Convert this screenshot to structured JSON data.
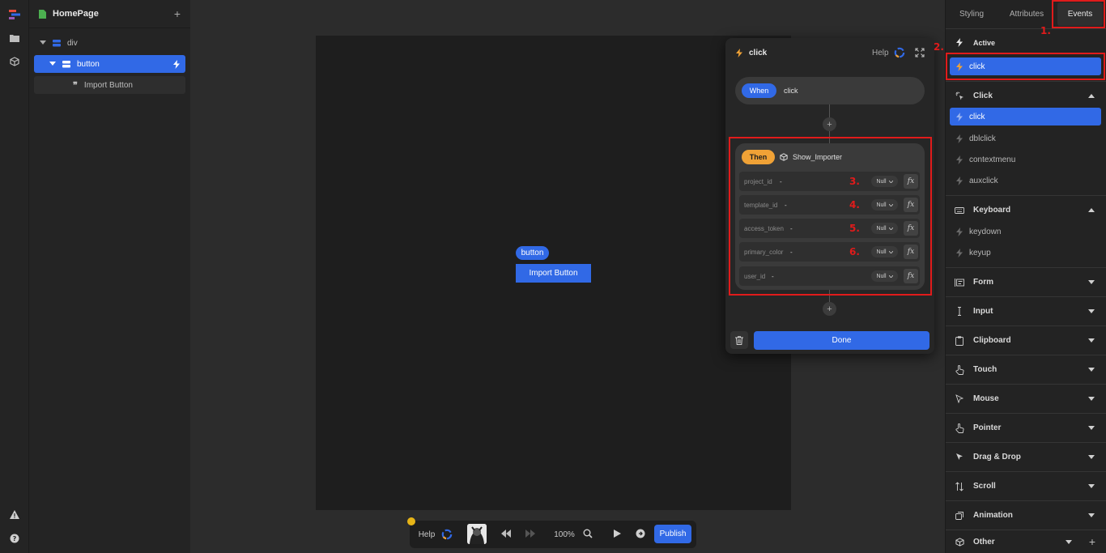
{
  "layers": {
    "page_title": "HomePage",
    "tree": [
      {
        "label": "div"
      },
      {
        "label": "button"
      },
      {
        "label": "Import Button"
      }
    ]
  },
  "canvas": {
    "element_tag": "button",
    "button_label": "Import Button"
  },
  "event_editor": {
    "title": "click",
    "help_label": "Help",
    "when_label": "When",
    "when_event": "click",
    "then_label": "Then",
    "action_name": "Show_Importer",
    "params": [
      {
        "name": "project_id",
        "value": "-",
        "type": "Null",
        "fx": "fx"
      },
      {
        "name": "template_id",
        "value": "-",
        "type": "Null",
        "fx": "fx"
      },
      {
        "name": "access_token",
        "value": "-",
        "type": "Null",
        "fx": "fx"
      },
      {
        "name": "primary_color",
        "value": "-",
        "type": "Null",
        "fx": "fx"
      },
      {
        "name": "user_id",
        "value": "-",
        "type": "Null",
        "fx": "fx"
      }
    ],
    "done_label": "Done"
  },
  "annotations": {
    "a1": "1.",
    "a2": "2.",
    "a3": "3.",
    "a4": "4.",
    "a5": "5.",
    "a6": "6."
  },
  "right_panel": {
    "tabs": [
      {
        "label": "Styling"
      },
      {
        "label": "Attributes"
      },
      {
        "label": "Events"
      }
    ],
    "active_title": "Active",
    "active_items": [
      "click"
    ],
    "click_group": {
      "title": "Click",
      "items": [
        "click",
        "dblclick",
        "contextmenu",
        "auxclick"
      ]
    },
    "keyboard_group": {
      "title": "Keyboard",
      "items": [
        "keydown",
        "keyup"
      ]
    },
    "sections": [
      "Form",
      "Input",
      "Clipboard",
      "Touch",
      "Mouse",
      "Pointer",
      "Drag & Drop",
      "Scroll",
      "Animation",
      "Other"
    ]
  },
  "toolbar": {
    "help_label": "Help",
    "zoom": "100%",
    "publish_label": "Publish"
  },
  "colors": {
    "accent": "#3169e6",
    "then_orange": "#f0a236",
    "annotation_red": "#e01b1b"
  }
}
